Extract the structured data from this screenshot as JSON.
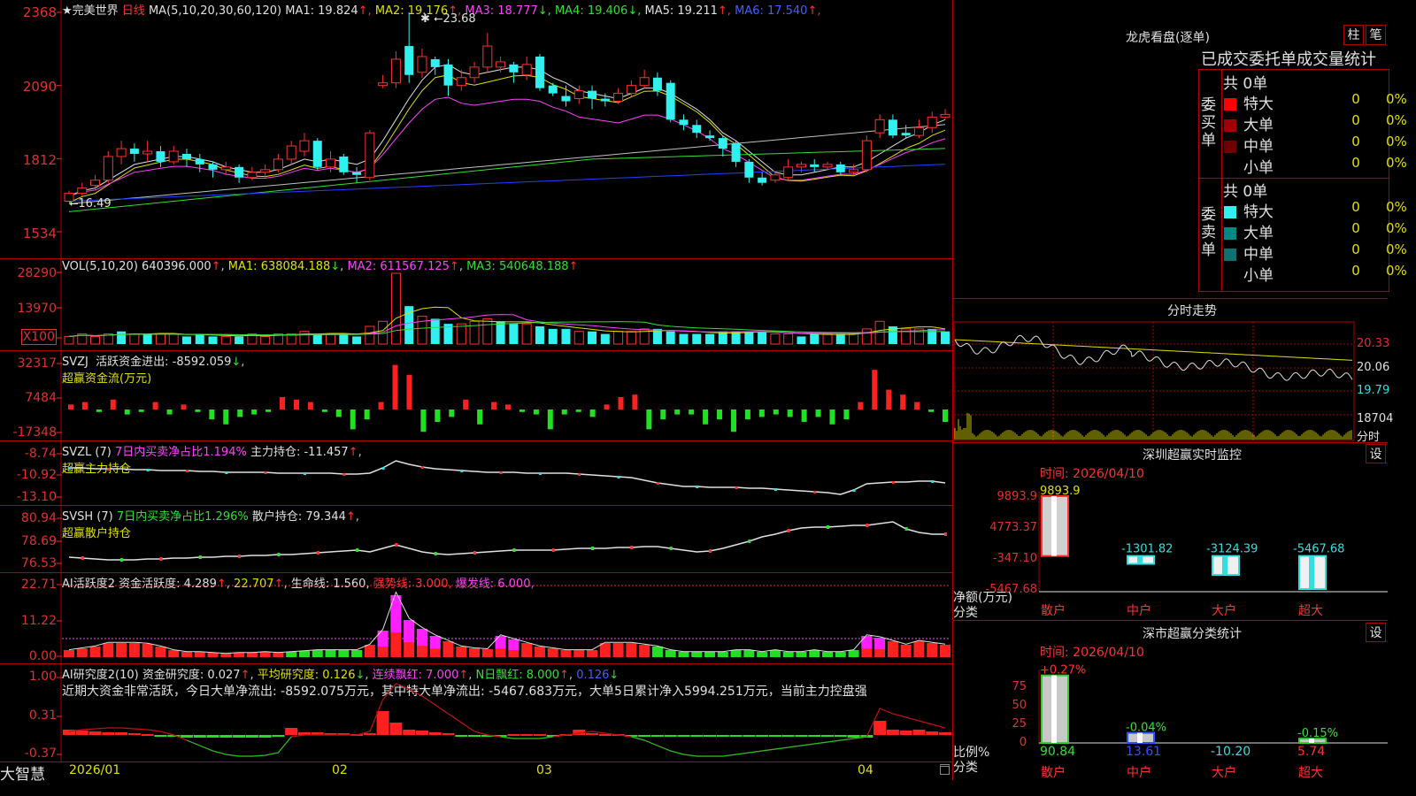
{
  "stock": {
    "name": "★完美世界",
    "period": "日线",
    "ma_params": "MA(5,10,20,30,60,120)"
  },
  "price_panel": {
    "y_labels": [
      "2368",
      "2090",
      "1812",
      "1534"
    ],
    "ma_values": [
      {
        "label": "MA1: 19.824",
        "arrow": "↑",
        "color": "#e0e0e0"
      },
      {
        "label": "MA2: 19.176",
        "arrow": "↑",
        "color": "#e0e000"
      },
      {
        "label": "MA3: 18.777",
        "arrow": "↓",
        "color": "#ff40ff"
      },
      {
        "label": "MA4: 19.406",
        "arrow": "↓",
        "color": "#30e030"
      },
      {
        "label": "MA5: 19.211",
        "arrow": "↑",
        "color": "#e0e0e0"
      },
      {
        "label": "MA6: 17.540",
        "arrow": "↑",
        "color": "#4060ff"
      }
    ],
    "high_annotation": "23.68",
    "low_annotation": "16.49"
  },
  "volume_panel": {
    "header": "VOL(5,10,20)",
    "value": "640396.000",
    "ma1": "MA1: 638084.188",
    "ma2": "MA2: 611567.125",
    "ma3": "MA3: 540648.188",
    "y_labels": [
      "28290",
      "13970",
      "X100"
    ]
  },
  "svzj_panel": {
    "header": "SVZJ",
    "line1": "活跃资金进出: -8592.059",
    "line2": "超赢资金流(万元)",
    "y_labels": [
      "32317",
      "7484",
      "-17348"
    ]
  },
  "svzl_panel": {
    "header": "SVZL (7)",
    "ratio": "7日内买卖净占比1.194%",
    "hold": "主力持仓: -11.457",
    "line2": "超赢主力持仓",
    "y_labels": [
      "-8.74",
      "-10.92",
      "-13.10"
    ]
  },
  "svsh_panel": {
    "header": "SVSH (7)",
    "ratio": "7日内买卖净占比1.296%",
    "hold": "散户持仓: 79.344",
    "line2": "超赢散户持仓",
    "y_labels": [
      "80.94",
      "78.69",
      "76.53"
    ]
  },
  "ai_active_panel": {
    "header": "AI活跃度2",
    "active": "资金活跃度: 4.289",
    "v2": "22.707",
    "life": "生命线: 1.560,",
    "strong": "强势线: 3.000,",
    "burst": "爆发线: 6.000,",
    "y_labels": [
      "22.71",
      "11.22",
      "0.00"
    ]
  },
  "ai_research_panel": {
    "header": "AI研究度2(10)",
    "research": "资金研究度: 0.027",
    "avg": "平均研究度: 0.126",
    "cont": "连续飘红: 7.000",
    "nday": "N日飘红: 8.000",
    "last": "0.126",
    "summary": "近期大资金非常活跃，今日大单净流出: -8592.075万元，其中特大单净流出: -5467.683万元，大单5日累计净入5994.251万元，当前主力控盘强",
    "y_labels": [
      "1.00",
      "0.31",
      "-0.37"
    ]
  },
  "x_axis": {
    "labels": [
      "2026/01",
      "02",
      "03",
      "04"
    ],
    "brand": "大智慧"
  },
  "dragon_tiger": {
    "title": "龙虎看盘(逐单)",
    "btn1": "柱",
    "btn2": "笔",
    "subtitle": "已成交委托单成交量统计",
    "buy_side_label": "委买单",
    "sell_side_label": "委卖单",
    "buy_total": "共 0单",
    "sell_total": "共 0单",
    "buy_rows": [
      {
        "name": "特大",
        "count": "0",
        "pct": "0%",
        "color": "#ff0000"
      },
      {
        "name": "大单",
        "count": "0",
        "pct": "0%",
        "color": "#a00000"
      },
      {
        "name": "中单",
        "count": "0",
        "pct": "0%",
        "color": "#700000"
      },
      {
        "name": "小单",
        "count": "0",
        "pct": "0%",
        "color": "#000000"
      }
    ],
    "sell_rows": [
      {
        "name": "特大",
        "count": "0",
        "pct": "0%",
        "color": "#30f0f0"
      },
      {
        "name": "大单",
        "count": "0",
        "pct": "0%",
        "color": "#008888"
      },
      {
        "name": "中单",
        "count": "0",
        "pct": "0%",
        "color": "#107070"
      },
      {
        "name": "小单",
        "count": "0",
        "pct": "0%",
        "color": "#000000"
      }
    ]
  },
  "intraday": {
    "title": "分时走势",
    "y_labels": [
      "20.33",
      "20.06",
      "19.79",
      "18704",
      "分时"
    ]
  },
  "sz_monitor": {
    "title": "深圳超赢实时监控",
    "btn": "设",
    "time": "时间: 2026/04/10",
    "y_labels": [
      "9893.9",
      "4773.37",
      "-347.10",
      "-5467.68"
    ],
    "ylabel1": "净额(万元)",
    "ylabel2": "分类",
    "categories": [
      "散户",
      "中户",
      "大户",
      "超大"
    ],
    "values": [
      9893.9,
      -1301.82,
      -3124.39,
      -5467.68
    ],
    "value_labels": [
      "9893.9",
      "-1301.82",
      "-3124.39",
      "-5467.68"
    ]
  },
  "sz_class": {
    "title": "深市超赢分类统计",
    "btn": "设",
    "time": "时间: 2026/04/10",
    "y_labels": [
      "75",
      "50",
      "25",
      "0"
    ],
    "ylabel1": "比例%",
    "ylabel2": "分类",
    "categories": [
      "散户",
      "中户",
      "大户",
      "超大"
    ],
    "change_labels": [
      "+0.27%",
      "-0.04%",
      "",
      "-0.15%"
    ],
    "values": [
      90.84,
      13.61,
      -10.2,
      5.74
    ],
    "value_labels": [
      "90.84",
      "13.61",
      "-10.20",
      "5.74"
    ]
  },
  "chart_data": [
    {
      "type": "candlestick",
      "title": "★完美世界 日线",
      "ylim": [
        15.34,
        23.68
      ],
      "x_labels": [
        "2026/01",
        "02",
        "03",
        "04"
      ],
      "candles": [
        [
          16.5,
          16.8,
          16.49,
          16.9
        ],
        [
          16.8,
          17.0,
          16.7,
          17.2
        ],
        [
          17.1,
          17.3,
          16.9,
          17.5
        ],
        [
          17.3,
          18.2,
          17.2,
          18.4
        ],
        [
          18.2,
          18.5,
          17.9,
          18.8
        ],
        [
          18.5,
          18.3,
          18.0,
          18.7
        ],
        [
          18.3,
          18.4,
          18.0,
          18.8
        ],
        [
          18.4,
          18.0,
          17.8,
          18.6
        ],
        [
          18.0,
          18.4,
          17.9,
          18.6
        ],
        [
          18.3,
          18.1,
          17.8,
          18.5
        ],
        [
          18.1,
          17.9,
          17.6,
          18.3
        ],
        [
          17.9,
          17.7,
          17.4,
          18.0
        ],
        [
          17.7,
          17.8,
          17.5,
          18.0
        ],
        [
          17.8,
          17.4,
          17.2,
          17.9
        ],
        [
          17.4,
          17.6,
          17.3,
          17.8
        ],
        [
          17.6,
          17.7,
          17.4,
          17.9
        ],
        [
          17.7,
          18.1,
          17.6,
          18.3
        ],
        [
          18.1,
          18.6,
          17.9,
          18.8
        ],
        [
          18.4,
          18.8,
          18.2,
          19.1
        ],
        [
          18.8,
          17.8,
          17.7,
          18.9
        ],
        [
          17.8,
          18.1,
          17.6,
          18.4
        ],
        [
          18.2,
          17.6,
          17.5,
          18.3
        ],
        [
          17.6,
          17.5,
          17.2,
          17.8
        ],
        [
          17.4,
          19.1,
          17.3,
          19.2
        ],
        [
          20.9,
          21.0,
          20.8,
          21.3
        ],
        [
          21.0,
          21.9,
          20.8,
          22.2
        ],
        [
          22.4,
          21.3,
          21.0,
          23.68
        ],
        [
          21.4,
          22.0,
          21.2,
          22.3
        ],
        [
          21.9,
          21.6,
          21.3,
          22.0
        ],
        [
          21.7,
          20.9,
          20.5,
          21.9
        ],
        [
          20.9,
          21.2,
          20.7,
          21.5
        ],
        [
          21.2,
          21.6,
          21.0,
          21.8
        ],
        [
          21.6,
          22.4,
          21.4,
          22.9
        ],
        [
          21.6,
          21.8,
          21.4,
          22.0
        ],
        [
          21.7,
          21.4,
          21.0,
          21.8
        ],
        [
          21.3,
          21.7,
          21.1,
          22.0
        ],
        [
          22.0,
          20.8,
          20.7,
          22.1
        ],
        [
          20.9,
          20.6,
          20.5,
          21.0
        ],
        [
          20.5,
          20.3,
          20.1,
          20.9
        ],
        [
          20.4,
          20.7,
          20.2,
          20.9
        ],
        [
          20.7,
          20.4,
          20.0,
          20.9
        ],
        [
          20.4,
          20.3,
          20.1,
          20.6
        ],
        [
          20.3,
          20.6,
          20.2,
          20.8
        ],
        [
          20.6,
          20.9,
          20.5,
          21.1
        ],
        [
          20.9,
          21.2,
          20.8,
          21.5
        ],
        [
          21.2,
          20.7,
          20.5,
          21.4
        ],
        [
          21.0,
          19.6,
          19.5,
          21.1
        ],
        [
          19.6,
          19.4,
          19.2,
          19.8
        ],
        [
          19.4,
          19.1,
          18.9,
          19.6
        ],
        [
          19.0,
          18.9,
          18.8,
          19.2
        ],
        [
          18.9,
          18.5,
          18.2,
          19.0
        ],
        [
          18.7,
          18.0,
          17.8,
          18.8
        ],
        [
          18.0,
          17.4,
          17.2,
          18.1
        ],
        [
          17.4,
          17.2,
          17.1,
          17.6
        ],
        [
          17.3,
          17.5,
          17.2,
          17.6
        ],
        [
          17.4,
          17.8,
          17.3,
          18.1
        ],
        [
          17.8,
          17.9,
          17.6,
          18.0
        ],
        [
          17.9,
          17.8,
          17.6,
          18.1
        ],
        [
          17.8,
          17.9,
          17.7,
          18.0
        ],
        [
          17.9,
          17.6,
          17.5,
          18.0
        ],
        [
          17.6,
          17.7,
          17.5,
          17.9
        ],
        [
          17.7,
          18.8,
          17.6,
          19.0
        ],
        [
          19.1,
          19.6,
          18.9,
          19.8
        ],
        [
          19.6,
          19.0,
          18.9,
          19.8
        ],
        [
          19.1,
          19.0,
          18.9,
          19.4
        ],
        [
          19.0,
          19.3,
          18.9,
          19.6
        ],
        [
          19.3,
          19.7,
          19.1,
          19.9
        ],
        [
          19.7,
          19.8,
          19.6,
          20.0
        ]
      ],
      "ma1": [
        16.7,
        16.9,
        17.0,
        17.3,
        17.6,
        17.9,
        18.0,
        18.1,
        18.2,
        18.2,
        18.1,
        18.0,
        17.8,
        17.7,
        17.6,
        17.6,
        17.7,
        17.9,
        18.1,
        18.0,
        18.1,
        18.0,
        17.9,
        18.1,
        18.8,
        19.6,
        20.4,
        21.1,
        21.6,
        21.7,
        21.4,
        21.3,
        21.4,
        21.5,
        21.6,
        21.6,
        21.5,
        21.2,
        21.0,
        20.7,
        20.6,
        20.5,
        20.4,
        20.6,
        20.8,
        20.8,
        20.6,
        20.3,
        20.0,
        19.6,
        19.1,
        18.8,
        18.4,
        18.0,
        17.6,
        17.5,
        17.5,
        17.6,
        17.7,
        17.8,
        17.8,
        18.0,
        18.3,
        18.6,
        18.9,
        19.1,
        19.4,
        19.6
      ],
      "series_names": [
        "MA1",
        "MA2",
        "MA3",
        "MA4",
        "MA5",
        "MA6"
      ]
    },
    {
      "type": "bar",
      "title": "VOL(5,10,20)",
      "ylim": [
        0,
        28290
      ],
      "values": [
        3,
        4,
        3,
        4,
        5,
        4,
        4,
        4,
        4,
        3,
        4,
        3,
        3,
        3,
        4,
        3,
        4,
        4,
        5,
        4,
        4,
        4,
        3,
        7,
        9,
        28,
        15,
        11,
        10,
        8,
        8,
        9,
        10,
        9,
        8,
        8,
        7,
        6,
        6,
        5,
        5,
        4,
        5,
        5,
        6,
        6,
        5,
        4,
        4,
        4,
        5,
        5,
        5,
        5,
        4,
        4,
        3,
        4,
        4,
        4,
        4,
        6,
        9,
        7,
        6,
        6,
        6,
        5
      ],
      "colors": [
        "r",
        "r",
        "r",
        "r",
        "c",
        "r",
        "c",
        "r",
        "r",
        "c",
        "c",
        "c",
        "r",
        "c",
        "r",
        "r",
        "r",
        "r",
        "r",
        "c",
        "r",
        "c",
        "c",
        "r",
        "r",
        "r",
        "c",
        "r",
        "c",
        "c",
        "r",
        "r",
        "r",
        "c",
        "c",
        "r",
        "c",
        "c",
        "c",
        "r",
        "c",
        "c",
        "r",
        "r",
        "r",
        "c",
        "c",
        "c",
        "c",
        "c",
        "c",
        "c",
        "c",
        "c",
        "r",
        "r",
        "c",
        "c",
        "r",
        "c",
        "r",
        "r",
        "r",
        "c",
        "r",
        "r",
        "c",
        "c"
      ]
    },
    {
      "type": "bar",
      "title": "SVZJ 超赢资金流(万元)",
      "ylim": [
        -17348,
        32317
      ],
      "values": [
        0.2,
        0.3,
        -0.1,
        0.4,
        -0.2,
        -0.1,
        0.3,
        -0.2,
        0.2,
        -0.1,
        -0.4,
        -0.6,
        -0.3,
        -0.2,
        -0.1,
        0.5,
        0.4,
        0.3,
        -0.1,
        -0.3,
        -0.8,
        -0.4,
        0.3,
        1.8,
        1.4,
        -0.9,
        -0.5,
        -0.3,
        0.4,
        -0.6,
        0.3,
        0.2,
        -0.1,
        -0.2,
        -0.8,
        -0.2,
        -0.1,
        -0.3,
        0.2,
        0.5,
        0.6,
        -0.8,
        -0.4,
        -0.2,
        -0.2,
        -0.6,
        -0.4,
        -0.9,
        -0.4,
        -0.3,
        -0.2,
        -0.3,
        -0.5,
        -0.3,
        -0.6,
        -0.4,
        0.3,
        1.6,
        0.8,
        0.6,
        0.3,
        -0.1,
        -0.5
      ]
    }
  ]
}
